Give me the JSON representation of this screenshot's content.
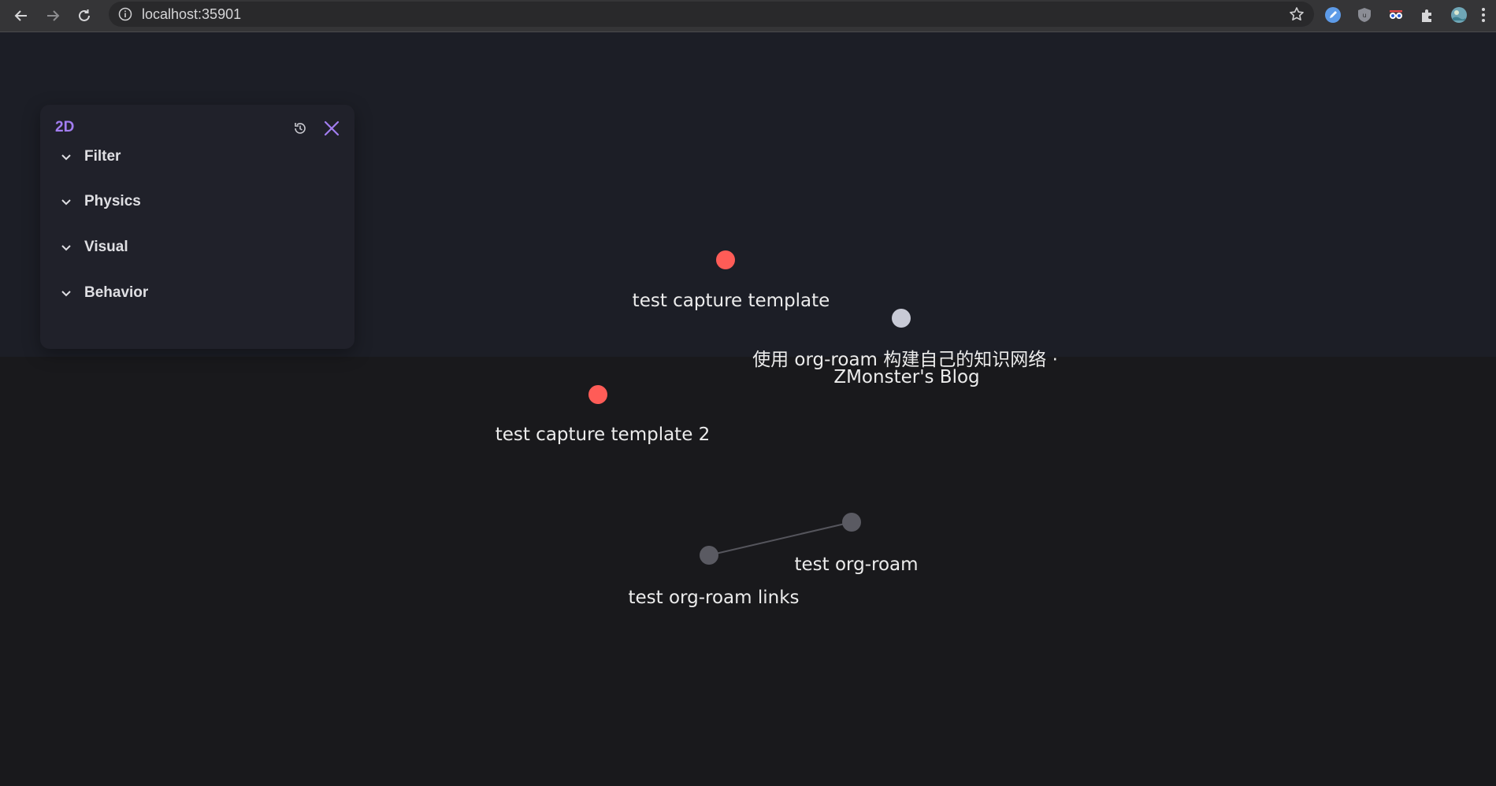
{
  "browser": {
    "url": "localhost:35901",
    "extensions": [
      "edit-extension-icon",
      "shield-extension-icon",
      "eyes-extension-icon",
      "puzzle-extensions-icon",
      "profile-avatar-icon"
    ]
  },
  "panel": {
    "title": "2D",
    "sections": [
      "Filter",
      "Physics",
      "Visual",
      "Behavior"
    ]
  },
  "graph": {
    "nodes": [
      {
        "id": "n1",
        "label": "test capture template",
        "color": "#ff5c57"
      },
      {
        "id": "n2",
        "label": "使用 org-roam 构建自己的知识网络 ·",
        "label2": "ZMonster's Blog",
        "color": "#c8cad6"
      },
      {
        "id": "n3",
        "label": "test capture template 2",
        "color": "#ff5c57"
      },
      {
        "id": "n4",
        "label": "test org-roam",
        "color": "#5a5a62"
      },
      {
        "id": "n5",
        "label": "test org-roam links",
        "color": "#5a5a62"
      }
    ],
    "links": [
      [
        "n5",
        "n4"
      ]
    ],
    "colors": {
      "accent": "#a27df0",
      "link": "#55555c",
      "background": "#19191c"
    }
  }
}
